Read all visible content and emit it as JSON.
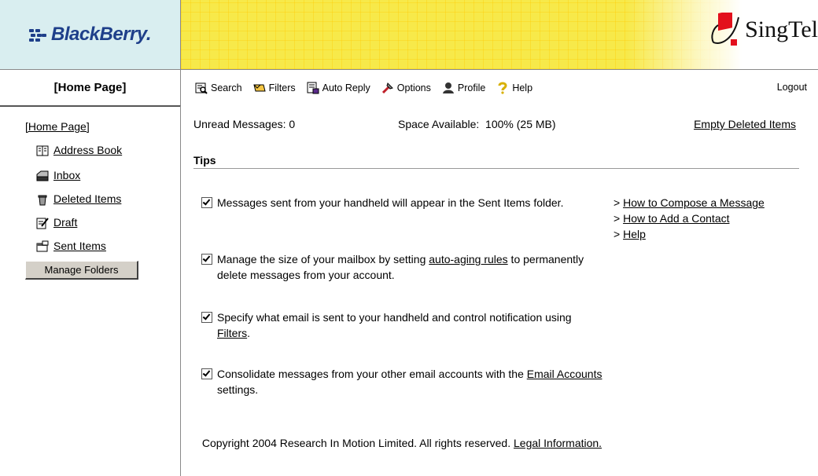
{
  "header": {
    "logo_text": "BlackBerry.",
    "carrier_text": "SingTel"
  },
  "homebar": {
    "label": "[Home Page]"
  },
  "toolbar": {
    "items": [
      {
        "label": "Search",
        "icon": "search-icon"
      },
      {
        "label": "Filters",
        "icon": "filters-icon"
      },
      {
        "label": "Auto Reply",
        "icon": "auto-reply-icon"
      },
      {
        "label": "Options",
        "icon": "options-icon"
      },
      {
        "label": "Profile",
        "icon": "profile-icon"
      },
      {
        "label": "Help",
        "icon": "help-icon"
      }
    ],
    "logout": "Logout"
  },
  "sidebar": {
    "home_link": "[Home Page]",
    "items": [
      {
        "label": "Address Book",
        "icon": "address-book-icon"
      },
      {
        "label": "Inbox",
        "icon": "inbox-icon"
      },
      {
        "label": "Deleted Items",
        "icon": "deleted-items-icon"
      },
      {
        "label": "Draft",
        "icon": "draft-icon"
      },
      {
        "label": "Sent Items",
        "icon": "sent-items-icon"
      }
    ],
    "manage_button": "Manage Folders"
  },
  "status": {
    "unread": "Unread Messages: 0",
    "space": "Space Available:  100% (25 MB)",
    "empty_link": "Empty Deleted Items"
  },
  "tips": {
    "title": "Tips",
    "items": [
      {
        "text": "Messages sent from your handheld will appear in the Sent Items folder."
      },
      {
        "pre": "Manage the size of your mailbox by setting ",
        "link": "auto-aging rules",
        "post": " to permanently delete messages from your account."
      },
      {
        "pre": "Specify what email is sent to your handheld and control notification using ",
        "link": "Filters",
        "post": "."
      },
      {
        "pre": "Consolidate messages from your other email accounts with the ",
        "link": "Email Accounts",
        "post": " settings."
      }
    ]
  },
  "quicklinks": [
    {
      "prefix": "> ",
      "label": "How to Compose a Message"
    },
    {
      "prefix": "> ",
      "label": "How to Add a Contact"
    },
    {
      "prefix": "> ",
      "label": "Help"
    }
  ],
  "footer": {
    "copyright": "Copyright 2004 Research In Motion Limited. All rights reserved. ",
    "legal_link": "Legal Information."
  }
}
